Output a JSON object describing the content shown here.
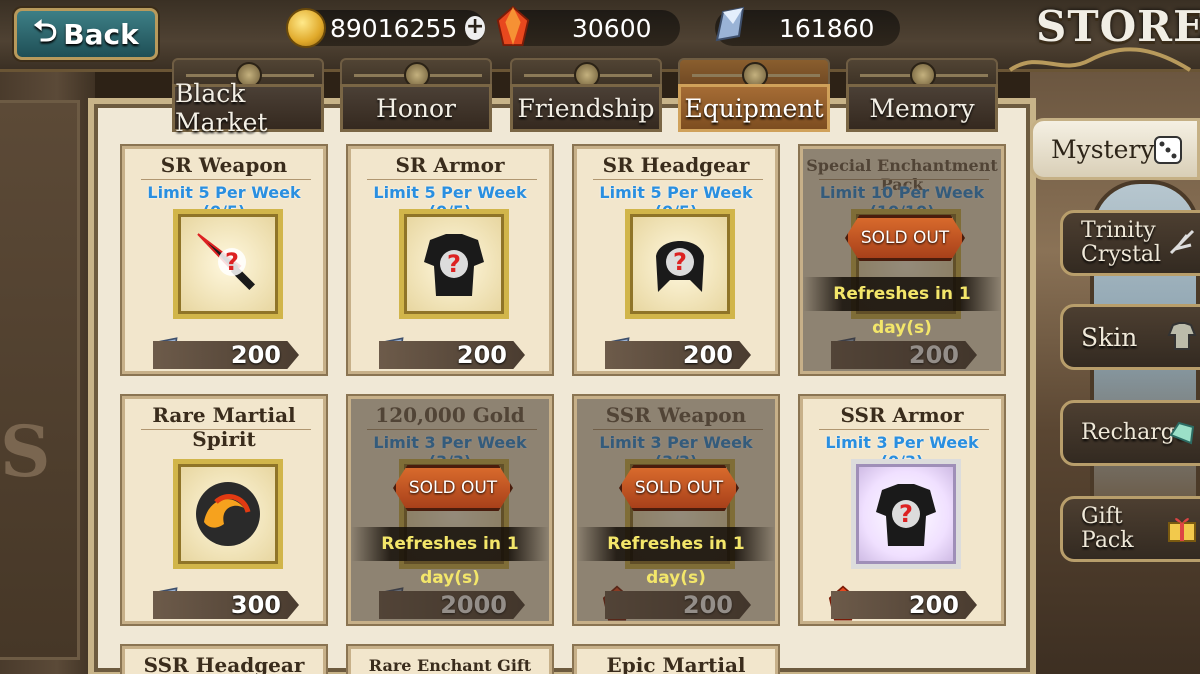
{
  "header": {
    "back_label": "Back",
    "store_title": "STORE",
    "gold": "89016255",
    "ruby": "30600",
    "crystal": "161860"
  },
  "tabs": [
    {
      "label": "Black Market",
      "active": false
    },
    {
      "label": "Honor",
      "active": false
    },
    {
      "label": "Friendship",
      "active": false
    },
    {
      "label": "Equipment",
      "active": true
    },
    {
      "label": "Memory",
      "active": false
    }
  ],
  "side_menu": [
    {
      "label": "Mystery"
    },
    {
      "label": "Trinity Crystal"
    },
    {
      "label": "Skin"
    },
    {
      "label": "Recharge"
    },
    {
      "label": "Gift Pack"
    }
  ],
  "items": [
    {
      "title": "SR Weapon",
      "limit": "Limit 5 Per Week (0/5)",
      "price": "200",
      "currency": "crystal",
      "icon": "sword-icon",
      "sold_out": false
    },
    {
      "title": "SR Armor",
      "limit": "Limit 5 Per Week (0/5)",
      "price": "200",
      "currency": "crystal",
      "icon": "armor-icon",
      "sold_out": false
    },
    {
      "title": "SR Headgear",
      "limit": "Limit 5 Per Week (0/5)",
      "price": "200",
      "currency": "crystal",
      "icon": "helmet-icon",
      "sold_out": false
    },
    {
      "title": "Special Enchantment Pack",
      "limit": "Limit 10 Per Week (10/10)",
      "price": "200",
      "currency": "crystal",
      "icon": "pack-icon",
      "sold_out": true
    },
    {
      "title": "Rare Martial Spirit",
      "limit": "",
      "price": "300",
      "currency": "crystal",
      "icon": "spirit-orb-icon",
      "sold_out": false
    },
    {
      "title": "120,000 Gold",
      "limit": "Limit 3 Per Week (3/3)",
      "price": "2000",
      "currency": "crystal",
      "icon": "gold-icon",
      "sold_out": true
    },
    {
      "title": "SSR Weapon",
      "limit": "Limit 3 Per Week (3/3)",
      "price": "200",
      "currency": "ruby",
      "icon": "sword-icon",
      "sold_out": true
    },
    {
      "title": "SSR Armor",
      "limit": "Limit 3 Per Week (0/3)",
      "price": "200",
      "currency": "ruby",
      "icon": "armor-icon",
      "sold_out": false
    },
    {
      "title": "SSR Headgear"
    },
    {
      "title": "Rare Enchant Gift Pack"
    },
    {
      "title": "Epic Martial Spirit"
    }
  ],
  "sold_out_label": "SOLD OUT",
  "refresh_label": "Refreshes in 1 day(s)"
}
